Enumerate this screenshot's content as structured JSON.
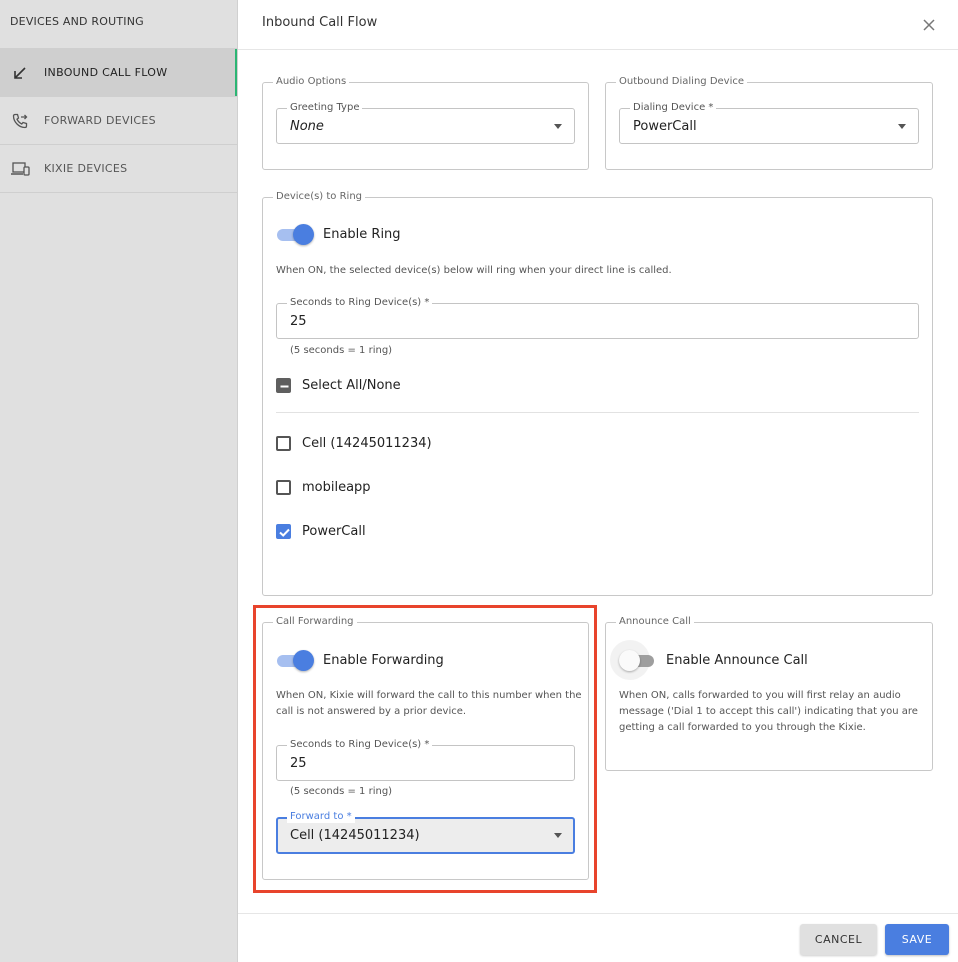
{
  "sidebar": {
    "header": "DEVICES AND ROUTING",
    "items": [
      {
        "label": "INBOUND CALL FLOW",
        "icon": "arrow-down-left-icon",
        "active": true
      },
      {
        "label": "FORWARD DEVICES",
        "icon": "phone-forward-icon",
        "active": false
      },
      {
        "label": "KIXIE DEVICES",
        "icon": "devices-icon",
        "active": false
      }
    ]
  },
  "main": {
    "title": "Inbound Call Flow",
    "audio_options": {
      "legend": "Audio Options",
      "greeting_type_label": "Greeting Type",
      "greeting_type_value": "None"
    },
    "outbound_dialing": {
      "legend": "Outbound Dialing Device",
      "dialing_device_label": "Dialing Device *",
      "dialing_device_value": "PowerCall"
    },
    "devices_to_ring": {
      "legend": "Device(s) to Ring",
      "toggle_label": "Enable Ring",
      "toggle_on": true,
      "description": "When ON, the selected device(s) below will ring when your direct line is called.",
      "seconds_label": "Seconds to Ring Device(s) *",
      "seconds_value": "25",
      "seconds_helper": "(5 seconds = 1 ring)",
      "select_all_label": "Select All/None",
      "devices": [
        {
          "label": "Cell (14245011234)",
          "checked": false
        },
        {
          "label": "mobileapp",
          "checked": false
        },
        {
          "label": "PowerCall",
          "checked": true
        }
      ]
    },
    "call_forwarding": {
      "legend": "Call Forwarding",
      "toggle_label": "Enable Forwarding",
      "toggle_on": true,
      "description_line1": "When ON, Kixie will forward the call to this number when the",
      "description_line2": "call is not answered by a prior device.",
      "seconds_label": "Seconds to Ring Device(s) *",
      "seconds_value": "25",
      "seconds_helper": "(5 seconds = 1 ring)",
      "forward_to_label": "Forward to *",
      "forward_to_value": "Cell (14245011234)"
    },
    "announce_call": {
      "legend": "Announce Call",
      "toggle_label": "Enable Announce Call",
      "toggle_on": false,
      "description_line1": "When ON, calls forwarded to you will first relay an audio",
      "description_line2": "message ('Dial 1 to accept this call') indicating that you are",
      "description_line3": "getting a call forwarded to you through the Kixie."
    }
  },
  "footer": {
    "cancel_label": "CANCEL",
    "save_label": "SAVE"
  },
  "colors": {
    "accent": "#4a7ee0",
    "highlight": "#e8442c",
    "active_indicator": "#2bb573"
  }
}
